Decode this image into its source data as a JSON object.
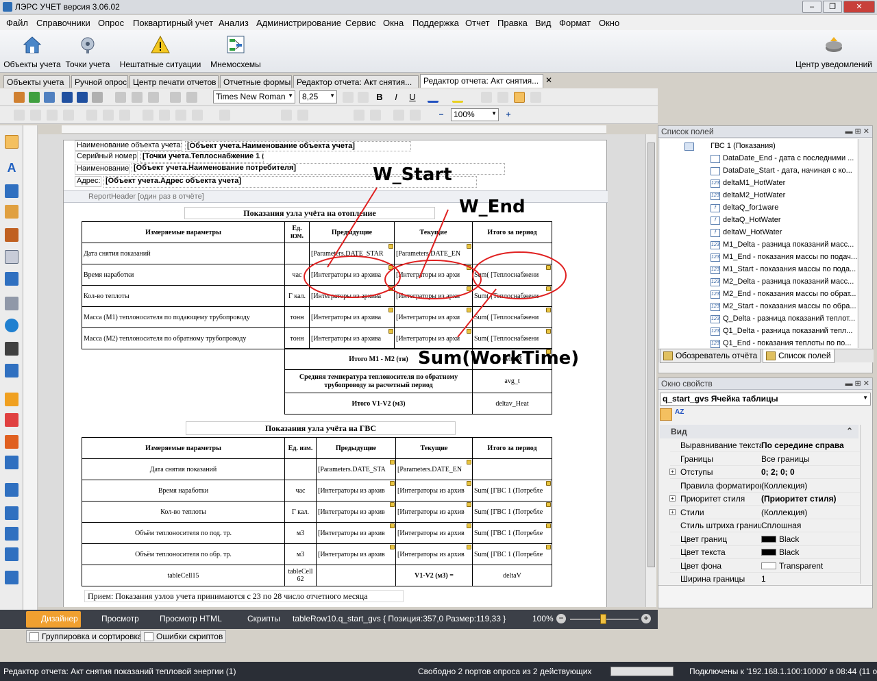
{
  "window": {
    "title": "ЛЭРС УЧЕТ версия 3.06.02",
    "min": "–",
    "max": "❐",
    "close": "✕"
  },
  "menu": [
    "Файл",
    "Справочники",
    "Опрос",
    "Поквартирный учет",
    "Анализ",
    "Администрирование",
    "Сервис",
    "Окна",
    "Поддержка",
    "Отчет",
    "Правка",
    "Вид",
    "Формат",
    "Окно"
  ],
  "ribbon": {
    "objects": "Объекты учета",
    "points": "Точки учета",
    "emergency": "Нештатные ситуации",
    "mnemo": "Мнемосхемы",
    "notifications": "Центр уведомлений"
  },
  "tabs": [
    "Объекты учета",
    "Ручной опрос",
    "Центр печати отчетов",
    "Отчетные формы",
    "Редактор отчета: Акт снятия...",
    "Редактор отчета: Акт снятия..."
  ],
  "format": {
    "font": "Times New Roman",
    "size": "8,25",
    "zoom": "100%",
    "bold": "B",
    "italic": "I",
    "underline": "U"
  },
  "header_fields": [
    {
      "label": "Наименование объекта учета:",
      "value": "[Объект учета.Наименование объекта учета]"
    },
    {
      "label": "Серийный номер:",
      "value": "[Точки учета.Теплоснабжение 1 ("
    },
    {
      "label": "Наименование:",
      "value": "[Объект учета.Наименование потребителя]"
    },
    {
      "label": "Адрес:",
      "value": "[Объект учета.Адрес объекта учета]"
    }
  ],
  "band_label": "ReportHeader [один раз в отчёте]",
  "heating": {
    "title": "Показания узла учёта на отопление",
    "headers": [
      "Измеряемые параметры",
      "Ед. изм.",
      "Предыдущие",
      "Текущие",
      "Итого за период"
    ],
    "rows": [
      [
        "Дата снятия показаний",
        "",
        "[Parameters.DATE_STAR",
        "[Parameters.DATE_EN",
        ""
      ],
      [
        "Время наработки",
        "час",
        "[Интеграторы из архива",
        "[Интеграторы из архи",
        "Sum( [Теплоснабжени"
      ],
      [
        "Кол-во теплоты",
        "Г кал.",
        "[Интеграторы из архива",
        "[Интеграторы из архи",
        "Sum( [Теплоснабжени"
      ],
      [
        "Масса (M1) теплоносителя по подающему трубопроводу",
        "тонн",
        "[Интеграторы из архива",
        "[Интеграторы из архи",
        "Sum( [Теплоснабжени"
      ],
      [
        "Масса (M2) теплоносителя по обратному трубопроводу",
        "тонн",
        "[Интеграторы из архива",
        "[Интеграторы из архи",
        "Sum( [Теплоснабжени"
      ]
    ],
    "summary": [
      [
        "Итого M1 - M2 (тн)",
        "deltaM"
      ],
      [
        "Средняя температура теплоносителя по обратному трубопроводу за расчетный период",
        "avg_t"
      ],
      [
        "Итого V1-V2 (м3)",
        "deltav_Heat"
      ]
    ]
  },
  "gvs": {
    "title": "Показания узла учёта на ГВС",
    "headers": [
      "Измеряемые параметры",
      "Ед. изм.",
      "Предыдущие",
      "Текущие",
      "Итого за период"
    ],
    "rows": [
      [
        "Дата снятия показаний",
        "",
        "[Parameters.DATE_STA",
        "[Parameters.DATE_EN",
        ""
      ],
      [
        "Время наработки",
        "час",
        "[Интеграторы из архив",
        "[Интеграторы из архив",
        "Sum( [ГВС 1 (Потребле"
      ],
      [
        "Кол-во теплоты",
        "Г кал.",
        "[Интеграторы из архив",
        "[Интеграторы из архив",
        "Sum( [ГВС 1 (Потребле"
      ],
      [
        "Объём теплоносителя по под. тр.",
        "м3",
        "[Интеграторы из архив",
        "[Интеграторы из архив",
        "Sum( [ГВС 1 (Потребле"
      ],
      [
        "Объём теплоносителя по обр. тр.",
        "м3",
        "[Интеграторы из архив",
        "[Интеграторы из архив",
        "Sum( [ГВС 1 (Потребле"
      ],
      [
        "tableCell15",
        "tableCell 62",
        "",
        "V1-V2 (м3) =",
        "deltaV"
      ]
    ]
  },
  "footer_note": "Прием:  Показания узлов  учета принимаются с 23 по 28 число отчетного месяца",
  "annotations": {
    "w_start": "W_Start",
    "w_end": "W_End",
    "sum_worktime": "Sum(WorkTime)"
  },
  "field_list": {
    "title": "Список полей",
    "root": "ГВС 1 (Показания)",
    "items": [
      {
        "label": "DataDate_End - дата с последними ...",
        "icon": "calendar"
      },
      {
        "label": "DataDate_Start - дата, начиная с ко...",
        "icon": "calendar"
      },
      {
        "label": "deltaM1_HotWater",
        "icon": "num"
      },
      {
        "label": "deltaM2_HotWater",
        "icon": "num"
      },
      {
        "label": "deltaQ_for1ware",
        "icon": "f"
      },
      {
        "label": "deltaQ_HotWater",
        "icon": "f"
      },
      {
        "label": "deltaW_HotWater",
        "icon": "f"
      },
      {
        "label": "M1_Delta - разница показаний масс...",
        "icon": "num"
      },
      {
        "label": "M1_End - показания массы по подач...",
        "icon": "num"
      },
      {
        "label": "M1_Start - показания массы по пода...",
        "icon": "num"
      },
      {
        "label": "M2_Delta - разница показаний масс...",
        "icon": "num"
      },
      {
        "label": "M2_End - показания массы по обрат...",
        "icon": "num"
      },
      {
        "label": "M2_Start - показания массы по обра...",
        "icon": "num"
      },
      {
        "label": "Q_Delta - разница показаний теплот...",
        "icon": "num"
      },
      {
        "label": "Q1_Delta - разница показаний тепл...",
        "icon": "num"
      },
      {
        "label": "Q1_End - показания теплоты по по...",
        "icon": "num"
      },
      {
        "label": "Q1_Start - показания теплоты по п...",
        "icon": "num"
      }
    ],
    "tab_explorer": "Обозреватель отчёта",
    "tab_fields": "Список полей"
  },
  "properties": {
    "title": "Окно свойств",
    "object": "q_start_gvs  Ячейка таблицы",
    "category": "Вид",
    "rows": [
      {
        "name": "Выравнивание текста",
        "value": "По середине справа",
        "bold": true
      },
      {
        "name": "Границы",
        "value": "Все границы"
      },
      {
        "name": "Отступы",
        "value": "0; 2; 0; 0",
        "bold": true,
        "expand": true
      },
      {
        "name": "Правила форматирова",
        "value": "(Коллекция)"
      },
      {
        "name": "Приоритет стиля",
        "value": "(Приоритет стиля)",
        "bold": true,
        "expand": true
      },
      {
        "name": "Стили",
        "value": "(Коллекция)",
        "expand": true
      },
      {
        "name": "Стиль штриха границ",
        "value": "Сплошная"
      },
      {
        "name": "Цвет границ",
        "value": "Black",
        "swatch": "#000000"
      },
      {
        "name": "Цвет текста",
        "value": "Black",
        "swatch": "#000000"
      },
      {
        "name": "Цвет фона",
        "value": "Transparent",
        "swatch": "#ffffff"
      },
      {
        "name": "Ширина границы",
        "value": "1"
      }
    ]
  },
  "designer_bar": {
    "designer": "Дизайнер",
    "preview": "Просмотр",
    "preview_html": "Просмотр HTML",
    "scripts": "Скрипты",
    "info": "tableRow10.q_start_gvs { Позиция:357,0 Размер:119,33 }",
    "zoom": "100%"
  },
  "bottom_tabs": [
    "Группировка и сортировка",
    "Ошибки скриптов"
  ],
  "status": {
    "left": "Редактор отчета: Акт снятия показаний тепловой энергии (1)",
    "ports": "Свободно 2 портов опроса из 2 действующих",
    "connection": "Подключены к '192.168.1.100:10000' в 08:44 (11 oct)"
  },
  "colors": {
    "accent": "#3874d4",
    "annotation_red": "#e02020",
    "marker": "#e8c440",
    "status_bg": "#2a2e36"
  }
}
